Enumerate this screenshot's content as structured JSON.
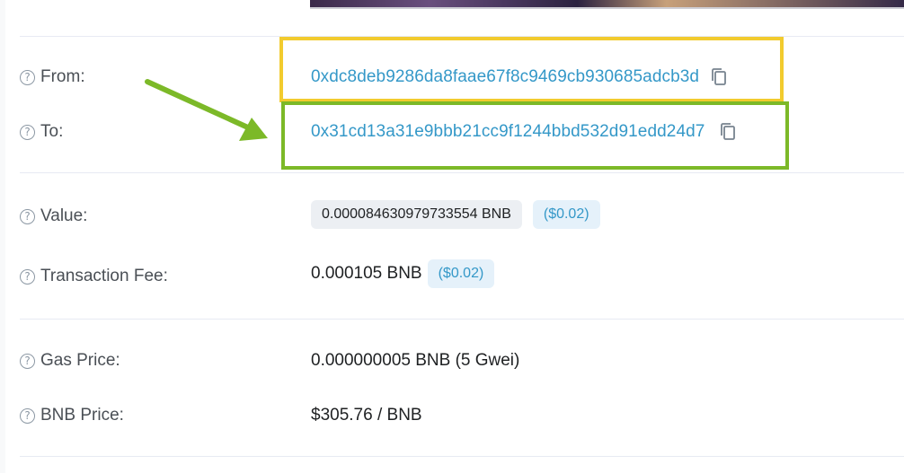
{
  "rows": {
    "from": {
      "label": "From:",
      "value": "0xdc8deb9286da8faae67f8c9469cb930685adcb3d"
    },
    "to": {
      "label": "To:",
      "value": "0x31cd13a31e9bbb21cc9f1244bbd532d91edd24d7"
    },
    "value": {
      "label": "Value:",
      "amount": "0.000084630979733554 BNB",
      "usd": "($0.02)"
    },
    "fee": {
      "label": "Transaction Fee:",
      "amount": "0.000105 BNB",
      "usd": "($0.02)"
    },
    "gas": {
      "label": "Gas Price:",
      "amount": "0.000000005 BNB (5 Gwei)"
    },
    "price": {
      "label": "BNB Price:",
      "amount": "$305.76 / BNB"
    }
  },
  "help_glyph": "?",
  "icons": {
    "help": "question-circle-icon",
    "copy": "copy-icon",
    "arrow": "green-arrow-annotation"
  },
  "colors": {
    "link": "#3498c8",
    "highlight_from": "#f2cb2e",
    "highlight_to": "#7cb928"
  }
}
